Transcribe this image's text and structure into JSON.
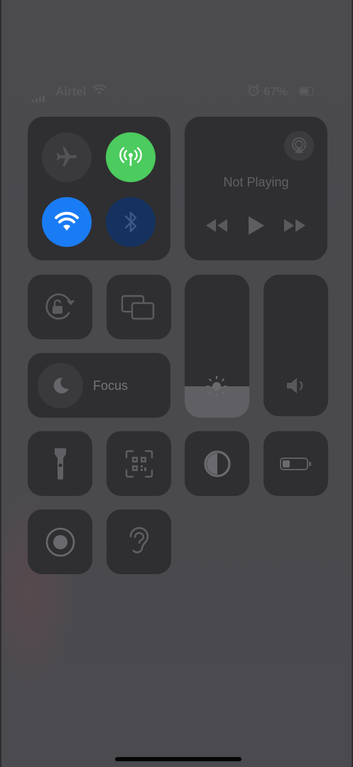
{
  "status_bar": {
    "carrier": "Airtel",
    "battery_percent": "67%"
  },
  "connectivity": {
    "airplane_mode": false,
    "cellular_data": true,
    "wifi": true,
    "bluetooth": true
  },
  "now_playing": {
    "label": "Not Playing"
  },
  "focus": {
    "label": "Focus"
  },
  "brightness_level": 0.22,
  "volume_level": 0.0,
  "colors": {
    "tile_bg": "#2f2f31",
    "cellular_on": "#4ccb5e",
    "wifi_on": "#1a7cf5",
    "bluetooth_on": "#14315f",
    "airplane_off": "#3a3a3c"
  },
  "icons": [
    "airplane-icon",
    "cellular-antenna-icon",
    "wifi-icon",
    "bluetooth-icon",
    "airplay-icon",
    "rewind-icon",
    "play-icon",
    "fast-forward-icon",
    "rotation-lock-icon",
    "screen-mirroring-icon",
    "moon-icon",
    "brightness-sun-icon",
    "volume-speaker-icon",
    "flashlight-icon",
    "qr-scanner-icon",
    "dark-mode-icon",
    "low-power-battery-icon",
    "screen-record-icon",
    "hearing-ear-icon"
  ]
}
